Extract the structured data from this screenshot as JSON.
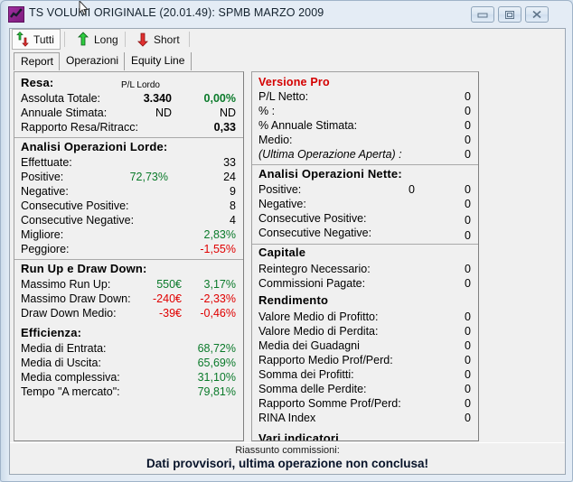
{
  "window": {
    "title": "TS VOLUMI ORIGINALE (20.01.49): SPMB MARZO 2009",
    "icon": "chart-line-icon",
    "buttons": {
      "minimize": "minimize-icon",
      "maximize": "restore-icon",
      "close": "close-icon"
    }
  },
  "toolbar": {
    "items": [
      {
        "label": "Tutti",
        "icon": "both-arrows-icon",
        "selected": true
      },
      {
        "label": "Long",
        "icon": "up-arrow-green-icon",
        "selected": false
      },
      {
        "label": "Short",
        "icon": "down-arrow-red-icon",
        "selected": false
      }
    ]
  },
  "tabs": [
    {
      "label": "Report",
      "active": true
    },
    {
      "label": "Operazioni",
      "active": false
    },
    {
      "label": "Equity Line",
      "active": false
    }
  ],
  "left_panel": {
    "groups": [
      {
        "header": "Resa:",
        "column_header": "P/L Lordo",
        "rows": [
          {
            "label": "Assoluta Totale:",
            "mid": "3.340",
            "mid_bold": true,
            "value": "0,00%",
            "value_color": "green",
            "value_bold": true
          },
          {
            "label": "Annuale Stimata:",
            "mid": "ND",
            "mid_bold": false,
            "value": "ND",
            "value_color": "black",
            "value_bold": false
          },
          {
            "label": "Rapporto Resa/Ritracc:",
            "mid": "",
            "mid_bold": false,
            "value": "0,33",
            "value_color": "black",
            "value_bold": true
          }
        ]
      },
      {
        "header": "Analisi Operazioni Lorde:",
        "rows": [
          {
            "label": "Effettuate:",
            "mid": "",
            "value": "33",
            "value_color": "black"
          },
          {
            "label": "Positive:",
            "mid": "72,73%",
            "mid_color": "green",
            "value": "24",
            "value_color": "black"
          },
          {
            "label": "Negative:",
            "mid": "",
            "value": "9",
            "value_color": "black"
          },
          {
            "label": "Consecutive Positive:",
            "mid": "",
            "value": "8",
            "value_color": "black"
          },
          {
            "label": "Consecutive Negative:",
            "mid": "",
            "value": "4",
            "value_color": "black"
          },
          {
            "label": "Migliore:",
            "mid": "",
            "value": "2,83%",
            "value_color": "green"
          },
          {
            "label": "Peggiore:",
            "mid": "",
            "value": "-1,55%",
            "value_color": "red"
          }
        ]
      },
      {
        "header": "Run Up e Draw Down:",
        "rows": [
          {
            "label": "Massimo Run Up:",
            "mid": "550€",
            "mid_color": "green",
            "value": "3,17%",
            "value_color": "green"
          },
          {
            "label": "Massimo Draw Down:",
            "mid": "-240€",
            "mid_color": "red",
            "value": "-2,33%",
            "value_color": "red"
          },
          {
            "label": "Draw Down Medio:",
            "mid": "-39€",
            "mid_color": "red",
            "value": "-0,46%",
            "value_color": "red"
          }
        ]
      },
      {
        "header": "Efficienza:",
        "rows": [
          {
            "label": "Media di Entrata:",
            "mid": "",
            "value": "68,72%",
            "value_color": "green"
          },
          {
            "label": "Media di Uscita:",
            "mid": "",
            "value": "65,69%",
            "value_color": "green"
          },
          {
            "label": "Media complessiva:",
            "mid": "",
            "value": "31,10%",
            "value_color": "green"
          },
          {
            "label": "Tempo \"A mercato\":",
            "mid": "",
            "value": "79,81%",
            "value_color": "green"
          }
        ]
      }
    ]
  },
  "right_panel": {
    "groups": [
      {
        "header": "Versione Pro",
        "header_color": "red",
        "rows": [
          {
            "label": "P/L Netto:",
            "mid": "",
            "value": "0"
          },
          {
            "label": "% :",
            "mid": "",
            "value": "0"
          },
          {
            "label": "% Annuale Stimata:",
            "mid": "",
            "value": "0"
          },
          {
            "label": "Medio:",
            "mid": "",
            "value": "0"
          },
          {
            "label": "(Ultima Operazione Aperta) :",
            "italic": true,
            "mid": "",
            "value": "0"
          }
        ]
      },
      {
        "header": "Analisi Operazioni Nette:",
        "rows": [
          {
            "label": "Positive:",
            "mid": "0",
            "value": "0"
          },
          {
            "label": "Negative:",
            "mid": "",
            "value": "0"
          },
          {
            "label": "Consecutive Positive:",
            "mid": "",
            "value": "0"
          },
          {
            "label": "Consecutive Negative:",
            "mid": "",
            "value": "0"
          }
        ]
      },
      {
        "header": "Capitale",
        "rows": [
          {
            "label": "Reintegro Necessario:",
            "mid": "",
            "value": "0"
          },
          {
            "label": "Commissioni Pagate:",
            "mid": "",
            "value": "0"
          }
        ]
      },
      {
        "header": "Rendimento",
        "rows": [
          {
            "label": "Valore Medio di Profitto:",
            "mid": "",
            "value": "0"
          },
          {
            "label": "Valore Medio di Perdita:",
            "mid": "",
            "value": "0"
          },
          {
            "label": "Media dei Guadagni",
            "mid": "",
            "value": "0"
          },
          {
            "label": "Rapporto Medio Prof/Perd:",
            "mid": "",
            "value": "0"
          },
          {
            "label": "Somma dei Profitti:",
            "mid": "",
            "value": "0"
          },
          {
            "label": "Somma delle Perdite:",
            "mid": "",
            "value": "0"
          },
          {
            "label": "Rapporto Somme Prof/Perd:",
            "mid": "",
            "value": "0"
          },
          {
            "label": "RINA Index",
            "mid": "",
            "value": "0"
          }
        ]
      },
      {
        "header": "Vari indicatori",
        "rows": []
      }
    ]
  },
  "footer": {
    "subtitle": "Riassunto commissioni:",
    "message": "Dati provvisori, ultima operazione non conclusa!"
  },
  "colors": {
    "profit_green": "#0a7a2a",
    "loss_red": "#e00000",
    "pro_red": "#d40000",
    "window_frame": "#d6e3f0",
    "panel_bg": "#f0f0f0"
  }
}
